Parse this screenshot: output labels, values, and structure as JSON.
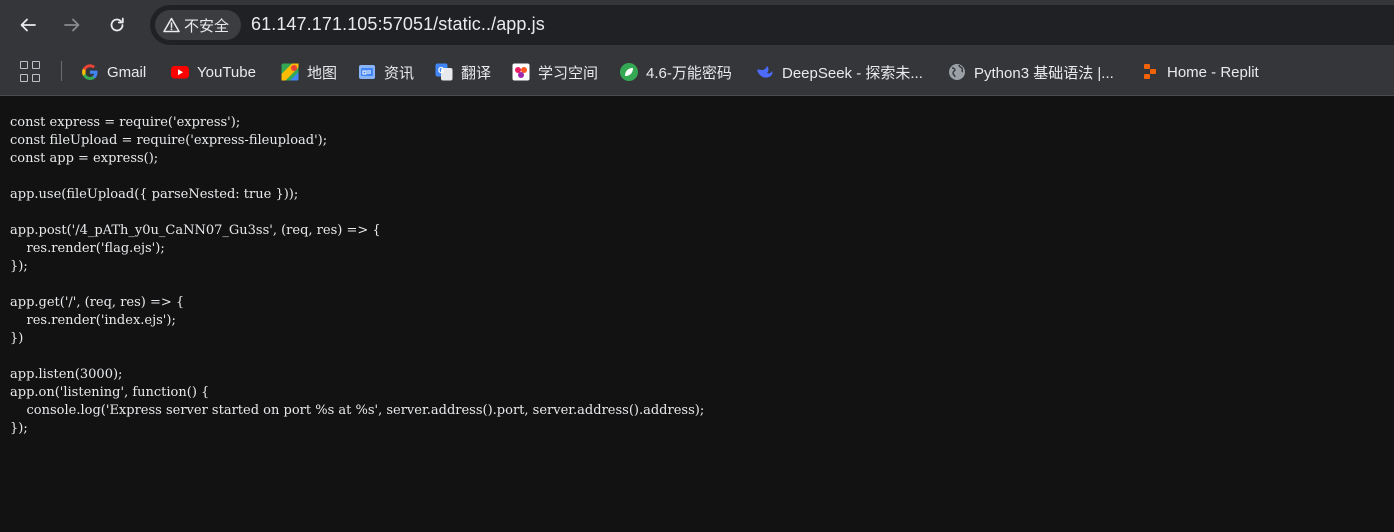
{
  "address_bar": {
    "security_label": "不安全",
    "url": "61.147.171.105:57051/static../app.js"
  },
  "bookmarks": [
    {
      "label": "Gmail",
      "icon": "google-icon"
    },
    {
      "label": "YouTube",
      "icon": "youtube-icon"
    },
    {
      "label": "地图",
      "icon": "maps-icon"
    },
    {
      "label": "资讯",
      "icon": "news-icon"
    },
    {
      "label": "翻译",
      "icon": "translate-icon"
    },
    {
      "label": "学习空间",
      "icon": "study-space-icon"
    },
    {
      "label": "4.6-万能密码",
      "icon": "green-leaf-icon"
    },
    {
      "label": "DeepSeek - 探索未...",
      "icon": "deepseek-icon"
    },
    {
      "label": "Python3 基础语法 |...",
      "icon": "globe-icon"
    },
    {
      "label": "Home - Replit",
      "icon": "replit-icon"
    }
  ],
  "code": "const express = require('express');\nconst fileUpload = require('express-fileupload');\nconst app = express();\n\napp.use(fileUpload({ parseNested: true }));\n\napp.post('/4_pATh_y0u_CaNN07_Gu3ss', (req, res) => {\n    res.render('flag.ejs');\n});\n\napp.get('/', (req, res) => {\n    res.render('index.ejs');\n})\n\napp.listen(3000);\napp.on('listening', function() {\n    console.log('Express server started on port %s at %s', server.address().port, server.address().address);\n});",
  "colors": {
    "toolbar": "#35363a",
    "omnibox": "#202124",
    "page_bg": "#121212",
    "text": "#e8eaed"
  }
}
